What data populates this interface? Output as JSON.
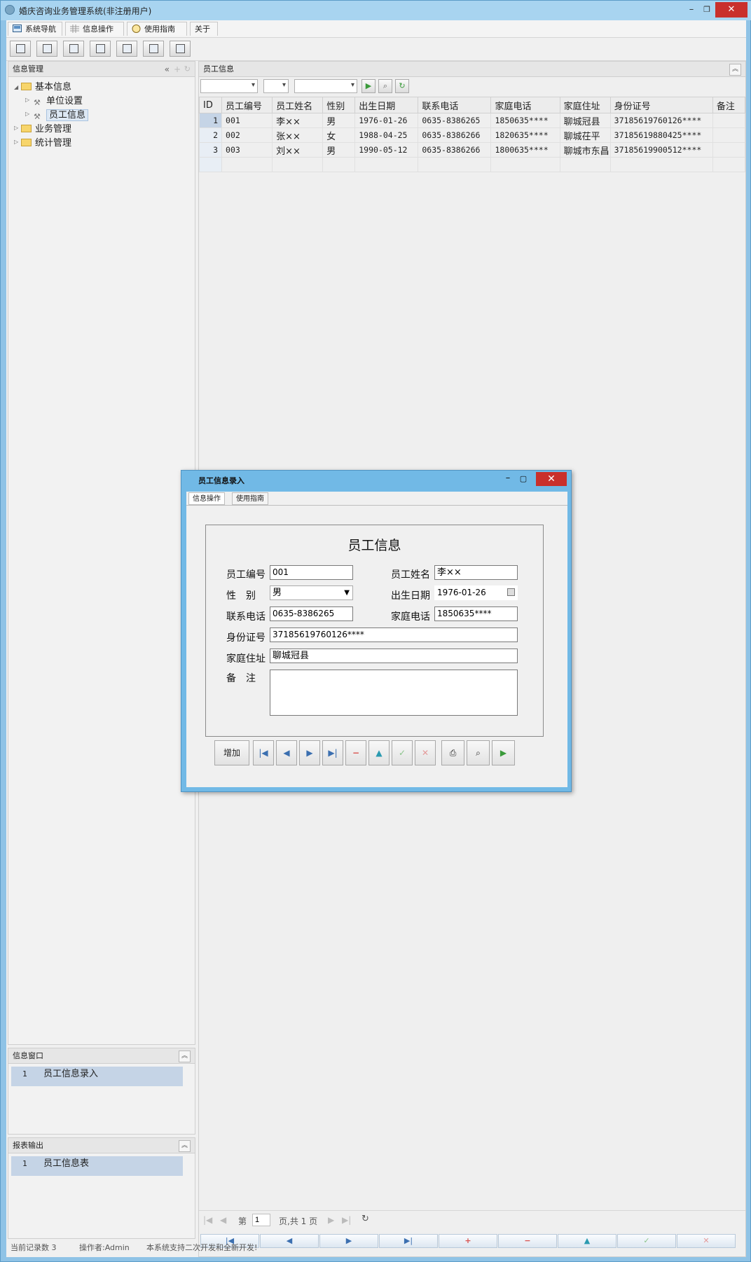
{
  "app": {
    "title": "婚庆咨询业务管理系统(非注册用户)"
  },
  "menu": {
    "tabs": [
      {
        "label": "系统导航",
        "icon": "navigation-icon"
      },
      {
        "label": "信息操作",
        "icon": "grid-icon"
      },
      {
        "label": "使用指南",
        "icon": "help-icon"
      },
      {
        "label": "关于",
        "icon": ""
      }
    ]
  },
  "toolbar": {
    "buttons": [
      "search-icon",
      "window-icon",
      "document-icon",
      "users-icon",
      "report-icon",
      "export-icon",
      "print-icon"
    ]
  },
  "left": {
    "header": "信息管理",
    "tree": [
      {
        "label": "基本信息"
      },
      {
        "label": "单位设置"
      },
      {
        "label": "员工信息"
      },
      {
        "label": "业务管理"
      },
      {
        "label": "统计管理"
      }
    ],
    "info_window": {
      "header": "信息窗口",
      "rows": [
        {
          "num": "1",
          "label": "员工信息录入"
        }
      ]
    },
    "report_output": {
      "header": "报表输出",
      "rows": [
        {
          "num": "1",
          "label": "员工信息表"
        }
      ]
    }
  },
  "grid": {
    "header": "员工信息",
    "columns": [
      "ID",
      "员工编号",
      "员工姓名",
      "性别",
      "出生日期",
      "联系电话",
      "家庭电话",
      "家庭住址",
      "身份证号",
      "备注"
    ],
    "rows": [
      [
        "1",
        "001",
        "李××",
        "男",
        "1976-01-26",
        "0635-8386265",
        "1850635****",
        "聊城冠县",
        "37185619760126****",
        ""
      ],
      [
        "2",
        "002",
        "张××",
        "女",
        "1988-04-25",
        "0635-8386266",
        "1820635****",
        "聊城茌平",
        "37185619880425****",
        ""
      ],
      [
        "3",
        "003",
        "刘××",
        "男",
        "1990-05-12",
        "0635-8386266",
        "1800635****",
        "聊城市东昌",
        "37185619900512****",
        ""
      ]
    ]
  },
  "pager": {
    "page_prefix": "第",
    "page_value": "1",
    "page_suffix": "页,共 1 页"
  },
  "status": {
    "record_count": "当前记录数 3",
    "operator": "操作者:Admin",
    "note": "本系统支持二次开发和全新开发!"
  },
  "dialog": {
    "title": "员工信息录入",
    "tabs": [
      "信息操作",
      "使用指南"
    ],
    "form_title": "员工信息",
    "labels": {
      "emp_no": "员工编号",
      "emp_name": "员工姓名",
      "gender": "性　别",
      "birth": "出生日期",
      "phone": "联系电话",
      "home_phone": "家庭电话",
      "id_card": "身份证号",
      "address": "家庭住址",
      "remark": "备　注"
    },
    "values": {
      "emp_no": "001",
      "emp_name": "李××",
      "gender": "男",
      "birth": "1976-01-26",
      "phone": "0635-8386265",
      "home_phone": "1850635****",
      "id_card": "37185619760126****",
      "address": "聊城冠县",
      "remark": ""
    },
    "add_label": "增加"
  },
  "colors": {
    "title_bar": "#a8d4f0",
    "dialog_frame": "#71b9e6",
    "close_red": "#c9302c",
    "selected_row": "#c5d4e6"
  }
}
